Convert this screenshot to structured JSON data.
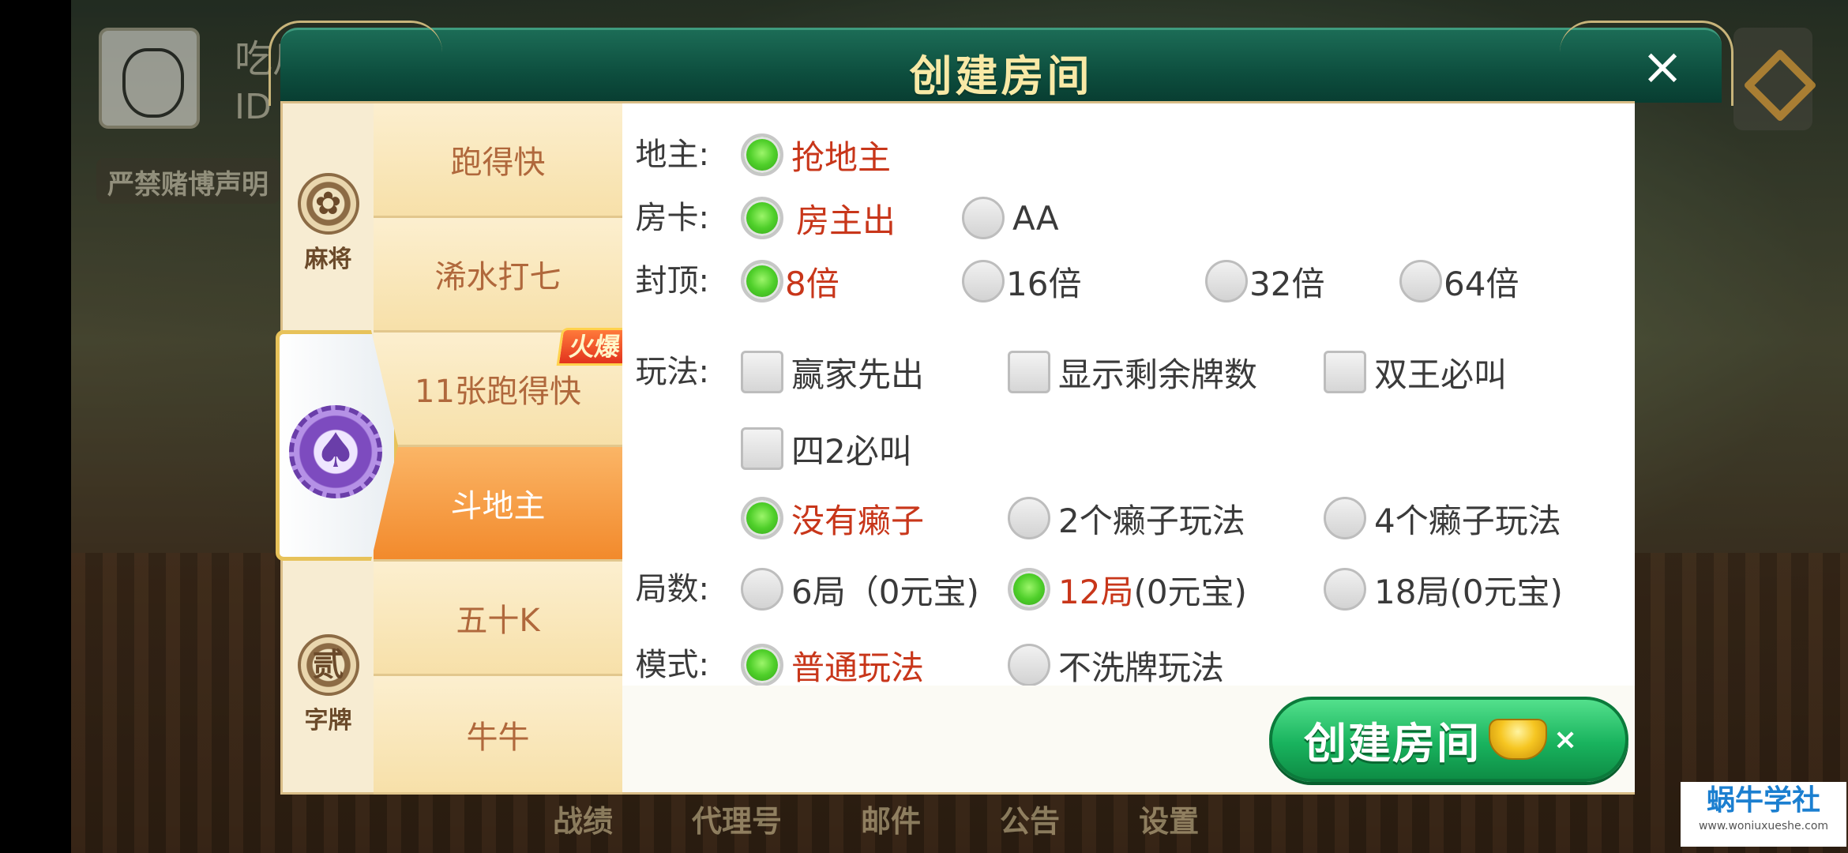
{
  "background": {
    "username": "吃瓜群众",
    "user_id": "ID",
    "disclaimer": "严禁赌博声明",
    "bottom_nav": [
      "战绩",
      "代理号",
      "邮件",
      "公告",
      "设置"
    ]
  },
  "modal": {
    "title": "创建房间",
    "close_label": "×",
    "categories": [
      {
        "label": "麻将",
        "icon": "mahjong-medal-icon"
      },
      {
        "label": "",
        "icon": "spade-chip-icon"
      },
      {
        "label": "字牌",
        "icon": "zipai-medal-icon",
        "glyph": "贰"
      }
    ],
    "games": [
      {
        "label": "跑得快"
      },
      {
        "label": "浠水打七"
      },
      {
        "label": "11张跑得快",
        "badge": "火爆"
      },
      {
        "label": "斗地主"
      },
      {
        "label": "五十K"
      },
      {
        "label": "牛牛"
      }
    ],
    "selected_game": "斗地主",
    "options": {
      "dizhu": {
        "label": "地主:",
        "choices": [
          "抢地主"
        ],
        "selected": "抢地主"
      },
      "fangka": {
        "label": "房卡:",
        "choices": [
          "房主出",
          "AA"
        ],
        "selected": "房主出"
      },
      "fengding": {
        "label": "封顶:",
        "choices": [
          "8倍",
          "16倍",
          "32倍",
          "64倍"
        ],
        "selected": "8倍"
      },
      "wanfa": {
        "label": "玩法:",
        "checks": [
          "赢家先出",
          "显示剩余牌数",
          "双王必叫",
          "四2必叫"
        ]
      },
      "laizi": {
        "choices": [
          "没有癞子",
          "2个癞子玩法",
          "4个癞子玩法"
        ],
        "selected": "没有癞子"
      },
      "jushu": {
        "label": "局数:",
        "choices": [
          "6局（0元宝)",
          "12局",
          "18局(0元宝)"
        ],
        "choice_suffix": "(0元宝)",
        "selected": "12局"
      },
      "moshi": {
        "label": "模式:",
        "choices": [
          "普通玩法",
          "不洗牌玩法"
        ],
        "selected": "普通玩法"
      }
    },
    "create_button": {
      "label": "创建房间",
      "cost": "×"
    }
  },
  "watermark": {
    "title": "蜗牛学社",
    "url": "www.woniuxueshe.com"
  },
  "colors": {
    "accent_green": "#19b35e",
    "selected_text": "#c8361a",
    "header": "#0d4e3e",
    "tab_active": "#f28a2c"
  }
}
